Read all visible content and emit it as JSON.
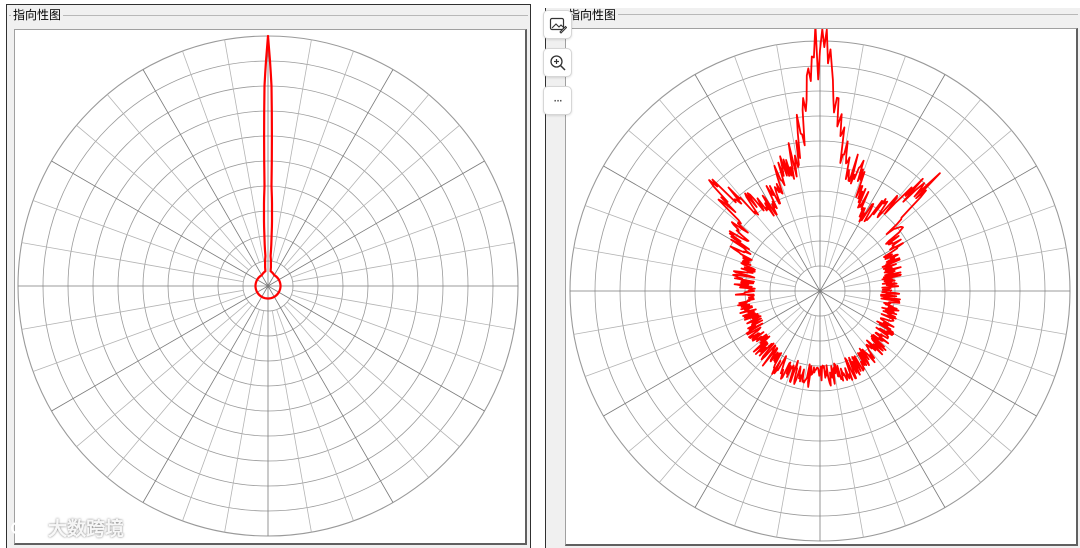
{
  "panels": [
    {
      "title": "指向性图"
    },
    {
      "title": "指向性图"
    }
  ],
  "toolbar": {
    "buttons": [
      {
        "icon": "image-edit-icon"
      },
      {
        "icon": "zoom-in-icon"
      },
      {
        "icon": "more-options-icon",
        "glyph": "···"
      }
    ]
  },
  "watermark": {
    "text": "大数跨境"
  },
  "colors": {
    "trace": "#ff0000",
    "grid": "#9a9a9a",
    "panel_bg": "#f0f0f0"
  },
  "chart_data": [
    {
      "type": "polar-line",
      "grid": true,
      "radial_rings": 10,
      "angular_spokes": 36,
      "series": [
        {
          "description_of_shape": "narrow main lobe at 90° (top), very small near-circular pattern elsewhere",
          "angles_deg": [
            0,
            30,
            60,
            80,
            85,
            88,
            89,
            90,
            91,
            92,
            95,
            100,
            120,
            150,
            180,
            210,
            240,
            270,
            300,
            330,
            360
          ],
          "r": [
            0.05,
            0.05,
            0.05,
            0.06,
            0.12,
            0.4,
            0.8,
            1.0,
            0.8,
            0.4,
            0.12,
            0.06,
            0.05,
            0.05,
            0.05,
            0.05,
            0.05,
            0.05,
            0.05,
            0.05,
            0.05
          ]
        }
      ]
    },
    {
      "type": "polar-line",
      "grid": true,
      "radial_rings": 10,
      "angular_spokes": 36,
      "series": [
        {
          "description_of_shape": "main lobe at 90° with spiky side lobes near 45° and 135°, noisy background level around 0.3",
          "angles_deg": [
            0,
            20,
            40,
            45,
            50,
            60,
            70,
            80,
            85,
            88,
            90,
            92,
            95,
            100,
            110,
            120,
            130,
            135,
            140,
            160,
            180,
            210,
            240,
            270,
            300,
            330,
            360
          ],
          "r": [
            0.28,
            0.3,
            0.38,
            0.62,
            0.45,
            0.36,
            0.48,
            0.55,
            0.7,
            0.9,
            0.98,
            0.9,
            0.7,
            0.55,
            0.48,
            0.4,
            0.45,
            0.58,
            0.42,
            0.32,
            0.3,
            0.3,
            0.34,
            0.34,
            0.33,
            0.3,
            0.28
          ]
        }
      ]
    }
  ]
}
